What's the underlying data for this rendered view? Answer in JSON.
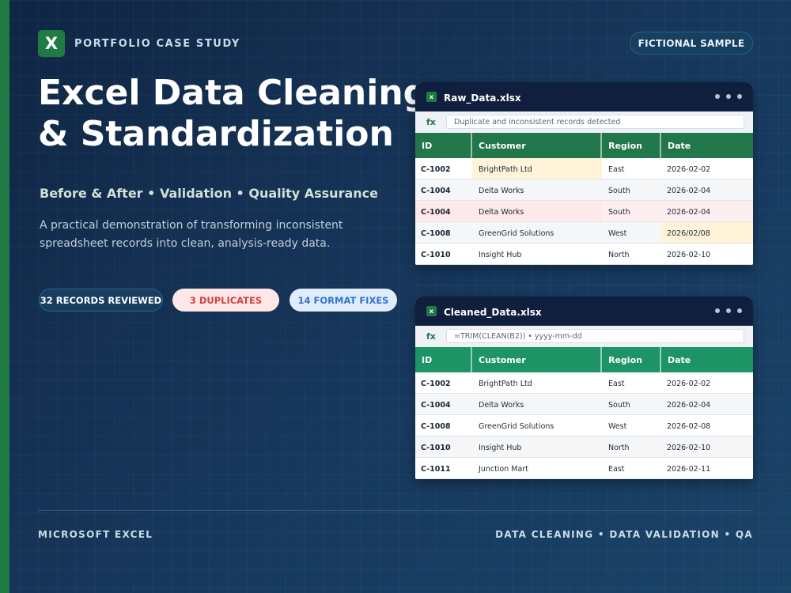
{
  "header": {
    "logo_letter": "X",
    "eyebrow": "PORTFOLIO CASE STUDY",
    "badge": "FICTIONAL SAMPLE"
  },
  "hero": {
    "title_line1": "Excel Data Cleaning",
    "title_line2": "& Standardization",
    "subtitle": "Before & After • Validation • Quality Assurance",
    "description": "A practical demonstration of transforming inconsistent spreadsheet records into clean, analysis-ready data."
  },
  "stats": {
    "records": "32 RECORDS REVIEWED",
    "duplicates": "3 DUPLICATES",
    "format_fixes": "14 FORMAT FIXES"
  },
  "raw_sheet": {
    "file_icon": "x",
    "file_name": "Raw_Data.xlsx",
    "fx_label": "fx",
    "formula": "Duplicate and inconsistent records detected",
    "columns": [
      "ID",
      "Customer",
      "Region",
      "Date"
    ],
    "rows": [
      [
        "C-1002",
        "BrightPath Ltd",
        "East",
        "2026-02-02"
      ],
      [
        "C-1004",
        "Delta Works",
        "South",
        "2026-02-04"
      ],
      [
        "C-1004",
        "Delta Works",
        "South",
        "2026-02-04"
      ],
      [
        "C-1008",
        "GreenGrid Solutions",
        "West",
        "2026/02/08"
      ],
      [
        "C-1010",
        "Insight Hub",
        "North",
        "2026-02-10"
      ]
    ]
  },
  "clean_sheet": {
    "file_icon": "x",
    "file_name": "Cleaned_Data.xlsx",
    "fx_label": "fx",
    "formula": "=TRIM(CLEAN(B2)) • yyyy-mm-dd",
    "columns": [
      "ID",
      "Customer",
      "Region",
      "Date"
    ],
    "rows": [
      [
        "C-1002",
        "BrightPath Ltd",
        "East",
        "2026-02-02"
      ],
      [
        "C-1004",
        "Delta Works",
        "South",
        "2026-02-04"
      ],
      [
        "C-1008",
        "GreenGrid Solutions",
        "West",
        "2026-02-08"
      ],
      [
        "C-1010",
        "Insight Hub",
        "North",
        "2026-02-10"
      ],
      [
        "C-1011",
        "Junction Mart",
        "East",
        "2026-02-11"
      ]
    ]
  },
  "footer": {
    "left": "MICROSOFT EXCEL",
    "right": "DATA CLEANING • DATA VALIDATION • QA"
  },
  "colors": {
    "excel_green": "#1f7a44",
    "clean_header_green": "#1c9466",
    "duplicate_red": "#d6413e",
    "fix_blue": "#2f74d0",
    "background_navy": "#163356"
  }
}
